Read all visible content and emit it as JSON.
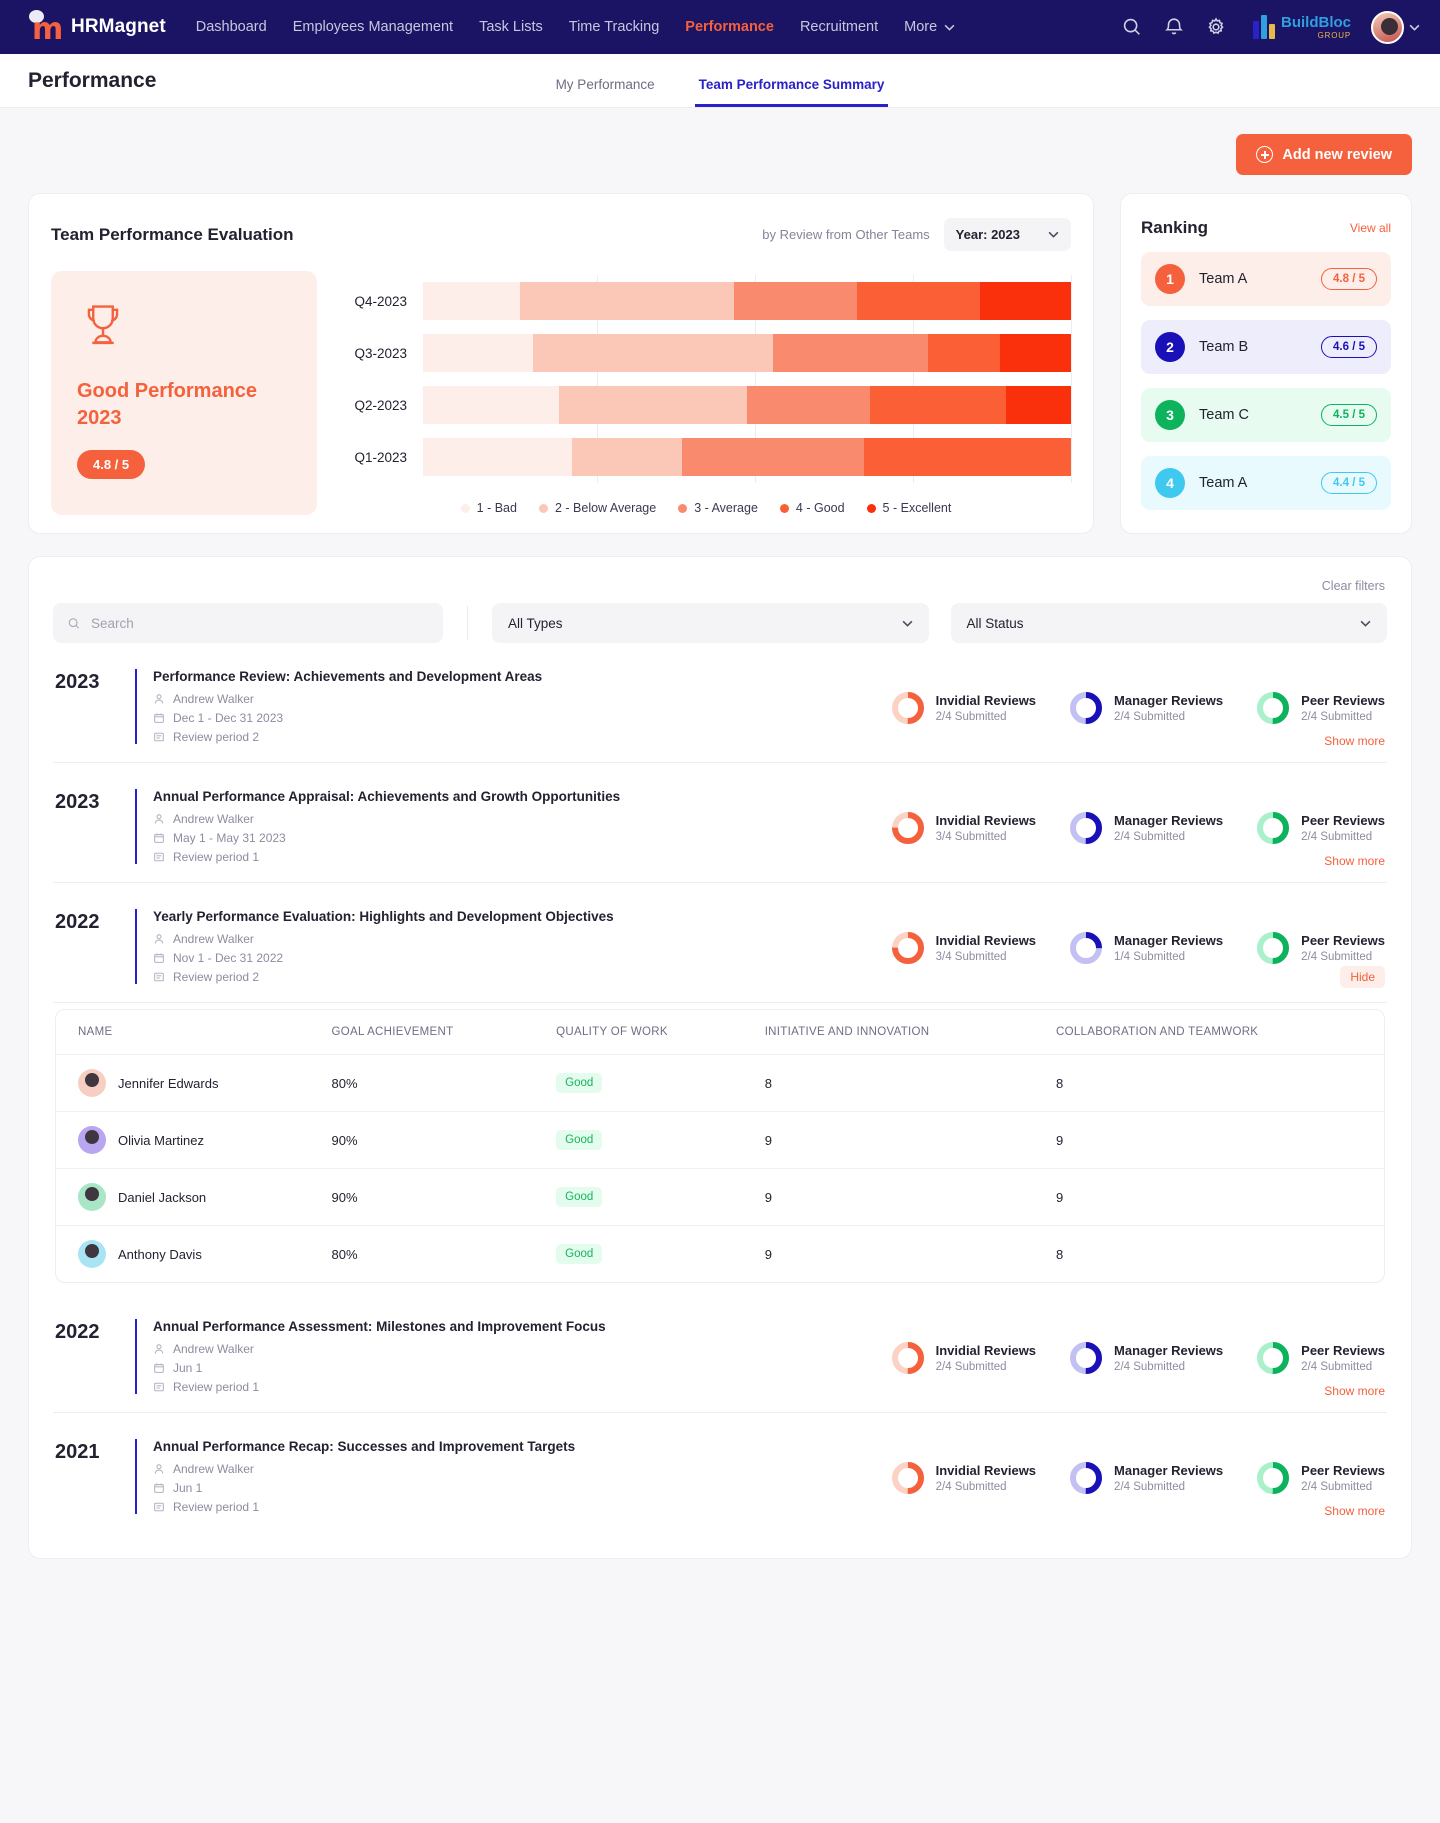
{
  "nav": {
    "brand": "HRMagnet",
    "links": [
      "Dashboard",
      "Employees Management",
      "Task Lists",
      "Time Tracking",
      "Performance",
      "Recruitment"
    ],
    "more_label": "More",
    "active_link": "Performance",
    "org_name": "BuildBloc",
    "org_sub": "GROUP",
    "icons": [
      "search-icon",
      "bell-icon",
      "gear-icon"
    ]
  },
  "header": {
    "title": "Performance",
    "tabs": [
      {
        "label": "My Performance",
        "active": false
      },
      {
        "label": "Team Performance Summary",
        "active": true
      }
    ]
  },
  "toolbar": {
    "add_review_label": "Add new review"
  },
  "evaluation": {
    "title": "Team Performance Evaluation",
    "subtitle": "by Review from Other Teams",
    "year_select": "Year: 2023",
    "award": {
      "title": "Good Performance",
      "year": "2023",
      "score": "4.8 / 5"
    }
  },
  "chart_data": {
    "type": "bar",
    "orientation": "horizontal",
    "stacked": true,
    "title": "Team Performance Evaluation",
    "xlabel": "",
    "ylabel": "",
    "xlim": [
      0,
      100
    ],
    "grid": true,
    "legend_position": "bottom",
    "categories": [
      "Q4-2023",
      "Q3-2023",
      "Q2-2023",
      "Q1-2023"
    ],
    "series": [
      {
        "name": "1 - Bad",
        "color": "#fdeee9",
        "values": [
          15,
          17,
          21,
          23
        ]
      },
      {
        "name": "2 - Below Average",
        "color": "#fbc8b8",
        "values": [
          33,
          37,
          29,
          17
        ]
      },
      {
        "name": "3 - Average",
        "color": "#fa8a6d",
        "values": [
          19,
          24,
          19,
          28
        ]
      },
      {
        "name": "4 - Good",
        "color": "#fb5f35",
        "values": [
          19,
          11,
          21,
          32
        ]
      },
      {
        "name": "5 - Excellent",
        "color": "#fa2f0c",
        "values": [
          14,
          11,
          10,
          0
        ]
      }
    ]
  },
  "ranking": {
    "title": "Ranking",
    "view_all": "View all",
    "items": [
      {
        "rank": "1",
        "team": "Team A",
        "score": "4.8 / 5",
        "color": "#f4613c",
        "bg": "#fdeee9"
      },
      {
        "rank": "2",
        "team": "Team B",
        "score": "4.6 / 5",
        "color": "#1a10b8",
        "bg": "#eeedfb"
      },
      {
        "rank": "3",
        "team": "Team C",
        "score": "4.5 / 5",
        "color": "#0cb35c",
        "bg": "#e8fbf1"
      },
      {
        "rank": "4",
        "team": "Team A",
        "score": "4.4 / 5",
        "color": "#3fc9ef",
        "bg": "#e9fafe"
      }
    ]
  },
  "filters": {
    "clear_label": "Clear filters",
    "search_placeholder": "Search",
    "search_value": "",
    "type_select": "All Types",
    "status_select": "All Status"
  },
  "reviews": [
    {
      "year": "2023",
      "name": "Performance Review: Achievements and Development Areas",
      "author": "Andrew Walker",
      "dates": "Dec 1 - Dec 31 2023",
      "period": "Review period 2",
      "action": "Show more",
      "expanded": false,
      "stats": [
        {
          "label": "Invidial Reviews",
          "sub": "2/4 Submitted",
          "done": 2,
          "total": 4,
          "color": "#f4613c",
          "track": "#fbd2c4"
        },
        {
          "label": "Manager Reviews",
          "sub": "2/4 Submitted",
          "done": 2,
          "total": 4,
          "color": "#1a10b8",
          "track": "#c3c0f2"
        },
        {
          "label": "Peer Reviews",
          "sub": "2/4 Submitted",
          "done": 2,
          "total": 4,
          "color": "#0cb35c",
          "track": "#a9f0cb"
        }
      ]
    },
    {
      "year": "2023",
      "name": "Annual Performance Appraisal: Achievements and Growth Opportunities",
      "author": "Andrew Walker",
      "dates": "May 1 - May 31 2023",
      "period": "Review period 1",
      "action": "Show more",
      "expanded": false,
      "stats": [
        {
          "label": "Invidial Reviews",
          "sub": "3/4 Submitted",
          "done": 3,
          "total": 4,
          "color": "#f4613c",
          "track": "#fbd2c4"
        },
        {
          "label": "Manager Reviews",
          "sub": "2/4 Submitted",
          "done": 2,
          "total": 4,
          "color": "#1a10b8",
          "track": "#c3c0f2"
        },
        {
          "label": "Peer Reviews",
          "sub": "2/4 Submitted",
          "done": 2,
          "total": 4,
          "color": "#0cb35c",
          "track": "#a9f0cb"
        }
      ]
    },
    {
      "year": "2022",
      "name": "Yearly Performance Evaluation: Highlights and Development Objectives",
      "author": "Andrew Walker",
      "dates": "Nov 1 - Dec 31 2022",
      "period": "Review period 2",
      "action": "Hide",
      "expanded": true,
      "stats": [
        {
          "label": "Invidial Reviews",
          "sub": "3/4 Submitted",
          "done": 3,
          "total": 4,
          "color": "#f4613c",
          "track": "#fbd2c4"
        },
        {
          "label": "Manager Reviews",
          "sub": "1/4 Submitted",
          "done": 1,
          "total": 4,
          "color": "#1a10b8",
          "track": "#c3c0f2"
        },
        {
          "label": "Peer Reviews",
          "sub": "2/4 Submitted",
          "done": 2,
          "total": 4,
          "color": "#0cb35c",
          "track": "#a9f0cb"
        }
      ]
    },
    {
      "year": "2022",
      "name": "Annual Performance Assessment: Milestones and Improvement Focus",
      "author": "Andrew Walker",
      "dates": "Jun 1",
      "period": "Review period 1",
      "action": "Show more",
      "expanded": false,
      "stats": [
        {
          "label": "Invidial Reviews",
          "sub": "2/4 Submitted",
          "done": 2,
          "total": 4,
          "color": "#f4613c",
          "track": "#fbd2c4"
        },
        {
          "label": "Manager Reviews",
          "sub": "2/4 Submitted",
          "done": 2,
          "total": 4,
          "color": "#1a10b8",
          "track": "#c3c0f2"
        },
        {
          "label": "Peer Reviews",
          "sub": "2/4 Submitted",
          "done": 2,
          "total": 4,
          "color": "#0cb35c",
          "track": "#a9f0cb"
        }
      ]
    },
    {
      "year": "2021",
      "name": "Annual Performance Recap: Successes and Improvement Targets",
      "author": "Andrew Walker",
      "dates": "Jun 1",
      "period": "Review period 1",
      "action": "Show more",
      "expanded": false,
      "stats": [
        {
          "label": "Invidial Reviews",
          "sub": "2/4 Submitted",
          "done": 2,
          "total": 4,
          "color": "#f4613c",
          "track": "#fbd2c4"
        },
        {
          "label": "Manager Reviews",
          "sub": "2/4 Submitted",
          "done": 2,
          "total": 4,
          "color": "#1a10b8",
          "track": "#c3c0f2"
        },
        {
          "label": "Peer Reviews",
          "sub": "2/4 Submitted",
          "done": 2,
          "total": 4,
          "color": "#0cb35c",
          "track": "#a9f0cb"
        }
      ]
    }
  ],
  "detail_table": {
    "columns": [
      "NAME",
      "GOAL ACHIEVEMENT",
      "QUALITY OF WORK",
      "INITIATIVE AND INNOVATION",
      "COLLABORATION AND TEAMWORK"
    ],
    "rows": [
      {
        "name": "Jennifer Edwards",
        "goal": "80%",
        "quality": "Good",
        "initiative": "8",
        "collaboration": "8",
        "avatar": "#f7cfc2"
      },
      {
        "name": "Olivia Martinez",
        "goal": "90%",
        "quality": "Good",
        "initiative": "9",
        "collaboration": "9",
        "avatar": "#b9a6f0"
      },
      {
        "name": "Daniel Jackson",
        "goal": "90%",
        "quality": "Good",
        "initiative": "9",
        "collaboration": "9",
        "avatar": "#a8e6c6"
      },
      {
        "name": "Anthony Davis",
        "goal": "80%",
        "quality": "Good",
        "initiative": "9",
        "collaboration": "8",
        "avatar": "#a9e4f5"
      }
    ]
  }
}
